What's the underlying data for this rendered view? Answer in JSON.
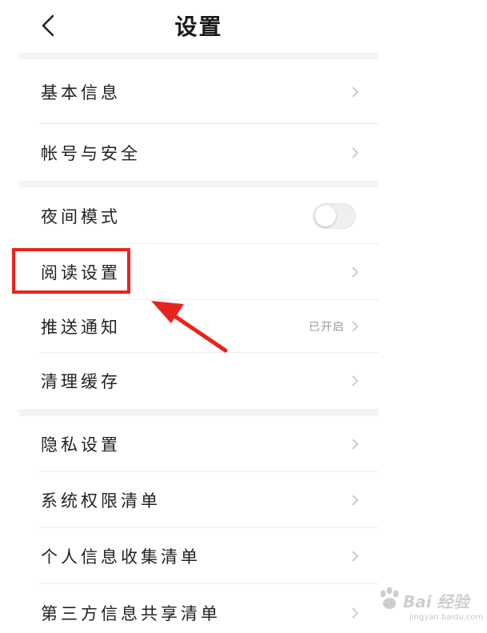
{
  "header": {
    "title": "设置",
    "back_icon": "chevron-left-icon"
  },
  "sections": [
    {
      "items": [
        {
          "label": "基本信息",
          "action": "chevron"
        },
        {
          "label": "帐号与安全",
          "action": "chevron"
        }
      ]
    },
    {
      "items": [
        {
          "label": "夜间模式",
          "action": "toggle",
          "toggle_on": false
        },
        {
          "label": "阅读设置",
          "action": "chevron",
          "highlighted": true
        },
        {
          "label": "推送通知",
          "action": "chevron",
          "status": "已开启"
        },
        {
          "label": "清理缓存",
          "action": "chevron"
        }
      ]
    },
    {
      "items": [
        {
          "label": "隐私设置",
          "action": "chevron"
        },
        {
          "label": "系统权限清单",
          "action": "chevron"
        },
        {
          "label": "个人信息收集清单",
          "action": "chevron"
        },
        {
          "label": "第三方信息共享清单",
          "action": "chevron"
        }
      ]
    }
  ],
  "annotation": {
    "color": "#e8231e",
    "highlight_target": "阅读设置",
    "arrow_icon": "red-arrow-icon"
  },
  "watermark": {
    "text": "Bai 经验",
    "subtext": "jingyan.baidu.com"
  },
  "colors": {
    "background": "#ffffff",
    "section_gap": "#f3f3f3",
    "separator": "#ececec",
    "text": "#222222",
    "secondary_text": "#9a9a9a",
    "chevron": "#c4c4c4"
  }
}
